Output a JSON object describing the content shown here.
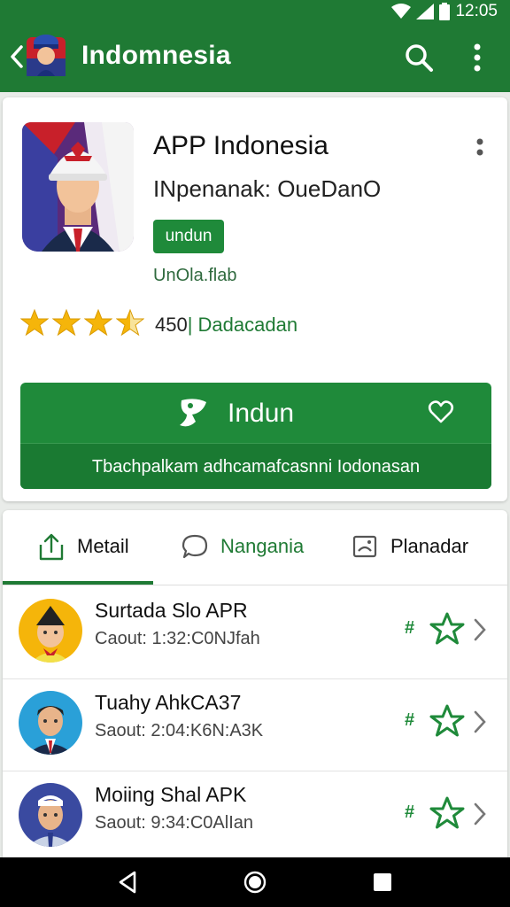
{
  "status_bar": {
    "time": "12:05"
  },
  "app_bar": {
    "title": "Indomnesia"
  },
  "app": {
    "name": "APP Indonesia",
    "developer": "INpenanak: OueDanO",
    "badge": "undun",
    "sublink": "UnOla.flab",
    "rating_count": "450",
    "category": "| Dadacadan",
    "stars_filled": 3.5,
    "install_label": "Indun",
    "install_note": "Tbachpalkam adhcamafcasnni Iodonasan"
  },
  "tabs": [
    {
      "label": "Metail",
      "icon": "share-icon"
    },
    {
      "label": "Nangania",
      "icon": "chat-bubble-icon"
    },
    {
      "label": "Planadar",
      "icon": "image-frame-icon"
    }
  ],
  "list": [
    {
      "title": "Surtada Slo APR",
      "subtitle": "Caout:  1:32:C0NJfah",
      "tag": "#"
    },
    {
      "title": "Tuahy AhkCA37",
      "subtitle": "Saout:  2:04:K6N:A3K",
      "tag": "#"
    },
    {
      "title": "Moiing Shal APK",
      "subtitle": "Saout:  9:34:C0AlIan",
      "tag": "#"
    }
  ],
  "colors": {
    "primary": "#1f7a34",
    "button": "#1f8a3a",
    "star": "#f5b50a"
  }
}
